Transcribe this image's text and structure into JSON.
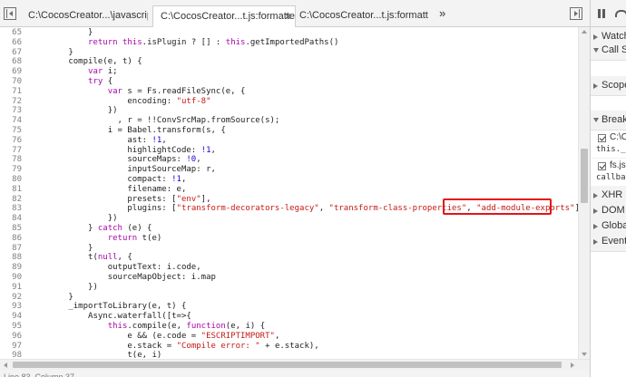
{
  "tabs": [
    {
      "label": "C:\\CocosCreator...\\javascript.js",
      "active": false
    },
    {
      "label": "C:\\CocosCreator...t.js:formatted",
      "active": true
    },
    {
      "label": "C:\\CocosCreator...t.js:formatted",
      "active": false
    }
  ],
  "tab_close_glyph": "×",
  "overflow_glyph": "»",
  "highlight_color": "#e3141a",
  "code_lines": [
    {
      "n": "65",
      "segs": [
        {
          "t": "            }"
        }
      ]
    },
    {
      "n": "66",
      "segs": [
        {
          "t": "            "
        },
        {
          "t": "return",
          "c": "kw"
        },
        {
          "t": " "
        },
        {
          "t": "this",
          "c": "kw"
        },
        {
          "t": ".isPlugin ? [] : "
        },
        {
          "t": "this",
          "c": "kw"
        },
        {
          "t": ".getImportedPaths()"
        }
      ]
    },
    {
      "n": "67",
      "segs": [
        {
          "t": "        }"
        }
      ]
    },
    {
      "n": "68",
      "segs": [
        {
          "t": "        compile(e, t) {"
        }
      ]
    },
    {
      "n": "69",
      "segs": [
        {
          "t": "            "
        },
        {
          "t": "var",
          "c": "kw"
        },
        {
          "t": " i;"
        }
      ]
    },
    {
      "n": "70",
      "segs": [
        {
          "t": "            "
        },
        {
          "t": "try",
          "c": "kw"
        },
        {
          "t": " {"
        }
      ]
    },
    {
      "n": "71",
      "segs": [
        {
          "t": "                "
        },
        {
          "t": "var",
          "c": "kw"
        },
        {
          "t": " s = Fs.readFileSync(e, {"
        }
      ]
    },
    {
      "n": "72",
      "segs": [
        {
          "t": "                    encoding: "
        },
        {
          "t": "\"utf-8\"",
          "c": "str"
        }
      ]
    },
    {
      "n": "73",
      "segs": [
        {
          "t": "                })"
        }
      ]
    },
    {
      "n": "74",
      "segs": [
        {
          "t": "                  , r = !!ConvSrcMap.fromSource(s);"
        }
      ]
    },
    {
      "n": "75",
      "segs": [
        {
          "t": "                i = Babel.transform(s, {"
        }
      ]
    },
    {
      "n": "76",
      "segs": [
        {
          "t": "                    ast: "
        },
        {
          "t": "!1",
          "c": "num"
        },
        {
          "t": ","
        }
      ]
    },
    {
      "n": "77",
      "segs": [
        {
          "t": "                    highlightCode: "
        },
        {
          "t": "!1",
          "c": "num"
        },
        {
          "t": ","
        }
      ]
    },
    {
      "n": "78",
      "segs": [
        {
          "t": "                    sourceMaps: "
        },
        {
          "t": "!0",
          "c": "num"
        },
        {
          "t": ","
        }
      ]
    },
    {
      "n": "79",
      "segs": [
        {
          "t": "                    inputSourceMap: r,"
        }
      ]
    },
    {
      "n": "80",
      "segs": [
        {
          "t": "                    compact: "
        },
        {
          "t": "!1",
          "c": "num"
        },
        {
          "t": ","
        }
      ]
    },
    {
      "n": "81",
      "segs": [
        {
          "t": "                    filename: e,"
        }
      ]
    },
    {
      "n": "82",
      "segs": [
        {
          "t": "                    presets: ["
        },
        {
          "t": "\"env\"",
          "c": "str"
        },
        {
          "t": "],"
        }
      ]
    },
    {
      "n": "83",
      "segs": [
        {
          "t": "                    plugins: ["
        },
        {
          "t": "\"transform-decorators-legacy\"",
          "c": "str"
        },
        {
          "t": ", "
        },
        {
          "t": "\"transform-class-properties\"",
          "c": "str"
        },
        {
          "t": ", "
        },
        {
          "t": "\"add-module-exports\"",
          "c": "str"
        },
        {
          "t": "]"
        }
      ]
    },
    {
      "n": "84",
      "segs": [
        {
          "t": "                })"
        }
      ]
    },
    {
      "n": "85",
      "segs": [
        {
          "t": "            } "
        },
        {
          "t": "catch",
          "c": "kw"
        },
        {
          "t": " (e) {"
        }
      ]
    },
    {
      "n": "86",
      "segs": [
        {
          "t": "                "
        },
        {
          "t": "return",
          "c": "kw"
        },
        {
          "t": " t(e)"
        }
      ]
    },
    {
      "n": "87",
      "segs": [
        {
          "t": "            }"
        }
      ]
    },
    {
      "n": "88",
      "segs": [
        {
          "t": "            t("
        },
        {
          "t": "null",
          "c": "kw"
        },
        {
          "t": ", {"
        }
      ]
    },
    {
      "n": "89",
      "segs": [
        {
          "t": "                outputText: i.code,"
        }
      ]
    },
    {
      "n": "90",
      "segs": [
        {
          "t": "                sourceMapObject: i.map"
        }
      ]
    },
    {
      "n": "91",
      "segs": [
        {
          "t": "            })"
        }
      ]
    },
    {
      "n": "92",
      "segs": [
        {
          "t": "        }"
        }
      ]
    },
    {
      "n": "93",
      "segs": [
        {
          "t": "        _importToLibrary(e, t) {"
        }
      ]
    },
    {
      "n": "94",
      "segs": [
        {
          "t": "            Async.waterfall([t=>{"
        }
      ]
    },
    {
      "n": "95",
      "segs": [
        {
          "t": "                "
        },
        {
          "t": "this",
          "c": "kw"
        },
        {
          "t": ".compile(e, "
        },
        {
          "t": "function",
          "c": "kw"
        },
        {
          "t": "(e, i) {"
        }
      ]
    },
    {
      "n": "96",
      "segs": [
        {
          "t": "                    e && (e.code = "
        },
        {
          "t": "\"ESCRIPTIMPORT\"",
          "c": "str"
        },
        {
          "t": ","
        }
      ]
    },
    {
      "n": "97",
      "segs": [
        {
          "t": "                    e.stack = "
        },
        {
          "t": "\"Compile error: \"",
          "c": "str"
        },
        {
          "t": " + e.stack),"
        }
      ]
    },
    {
      "n": "98",
      "segs": [
        {
          "t": "                    t(e, i)"
        }
      ]
    }
  ],
  "status_text": "Line 83, Column 37",
  "panel": {
    "sections": [
      {
        "label": "Watch",
        "open": false
      },
      {
        "label": "Call Stack",
        "open": true
      },
      {
        "label": "Scope",
        "open": false
      },
      {
        "label": "Breakpoints",
        "open": true
      },
      {
        "label": "XHR Breakpoints",
        "open": false
      },
      {
        "label": "DOM Breakpoints",
        "open": false
      },
      {
        "label": "Global Listeners",
        "open": false
      },
      {
        "label": "Event Listener Breakpoints",
        "open": false
      }
    ],
    "breakpoints": [
      {
        "file": "C:\\C",
        "snippet": "this._"
      },
      {
        "file": "fs.js",
        "snippet": "callba"
      }
    ]
  }
}
